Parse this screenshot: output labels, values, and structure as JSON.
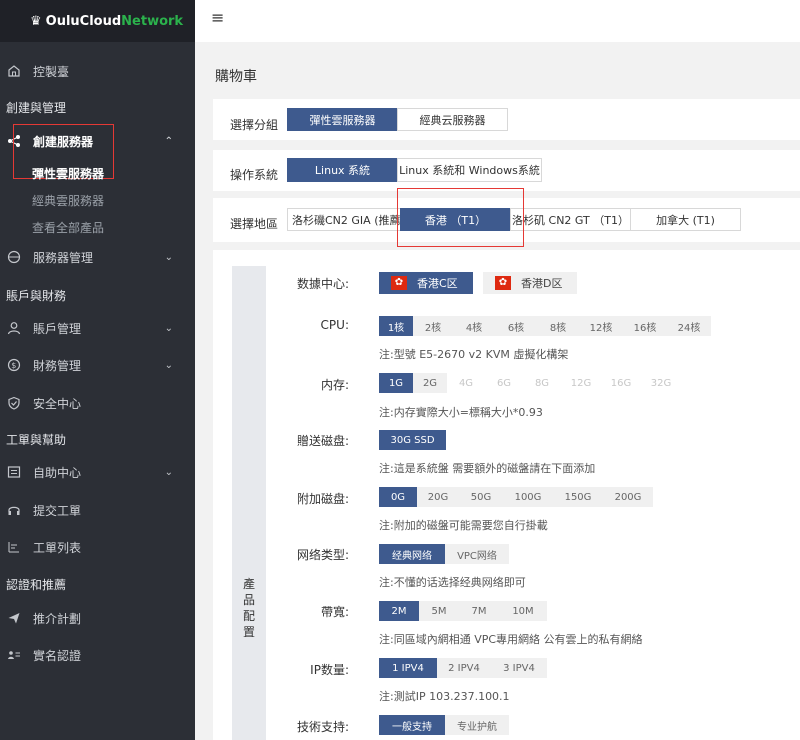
{
  "brand": {
    "logo_crown": "♛",
    "logo_white": "OuluCloud",
    "logo_green": "Network"
  },
  "sidebar": {
    "dashboard": "控製臺",
    "section_create": "創建與管理",
    "create_server": "創建服務器",
    "sub_elastic": "彈性雲服務器",
    "sub_classic": "經典雲服務器",
    "sub_all": "查看全部產品",
    "server_mgmt": "服務器管理",
    "section_account": "賬戶與財務",
    "account_mgmt": "賬戶管理",
    "finance_mgmt": "財務管理",
    "security": "安全中心",
    "section_ticket": "工單與幫助",
    "self_help": "自助中心",
    "submit_ticket": "提交工單",
    "ticket_list": "工單列表",
    "section_verify": "認證和推薦",
    "referral": "推介計劃",
    "realname": "實名認證"
  },
  "topbar": {
    "menu_icon": "≡"
  },
  "main": {
    "title": "購物車"
  },
  "group": {
    "label": "選擇分組",
    "options": [
      "彈性雲服務器",
      "經典云服務器"
    ],
    "selected": 0
  },
  "os": {
    "label": "操作系統",
    "options": [
      "Linux 系統",
      "Linux 系統和 Windows系統"
    ],
    "selected": 0
  },
  "region": {
    "label": "選擇地區",
    "options": [
      "洛杉磯CN2 GIA (推薦)",
      "香港 （T1）",
      "洛杉矶 CN2 GT （T1）",
      "加拿大 (T1)"
    ],
    "selected": 1
  },
  "config": {
    "band_label": "產品配置",
    "datacenter": {
      "label": "数據中心:",
      "options": [
        "香港C区",
        "香港D区"
      ],
      "selected": 0,
      "flag_glyph": "✿"
    },
    "cpu": {
      "label": "CPU:",
      "options": [
        "1核",
        "2核",
        "4核",
        "6核",
        "8核",
        "12核",
        "16核",
        "24核"
      ],
      "selected": 0,
      "note": "注:型號 E5-2670 v2 KVM 虛擬化構架"
    },
    "memory": {
      "label": "内存:",
      "options": [
        "1G",
        "2G",
        "4G",
        "6G",
        "8G",
        "12G",
        "16G",
        "32G"
      ],
      "selected": 0,
      "disabled_from": 2,
      "note": "注:内存實際大小=標稱大小*0.93"
    },
    "gift_disk": {
      "label": "贈送磁盘:",
      "options": [
        "30G SSD"
      ],
      "selected": 0,
      "note": "注:這是系統盤 需要額外的磁盤請在下面添加"
    },
    "extra_disk": {
      "label": "附加磁盘:",
      "options": [
        "0G",
        "20G",
        "50G",
        "100G",
        "150G",
        "200G"
      ],
      "selected": 0,
      "note": "注:附加的磁盤可能需要您自行掛載"
    },
    "net_type": {
      "label": "网络类型:",
      "options": [
        "经典网络",
        "VPC网络"
      ],
      "selected": 0,
      "note": "注:不懂的话选择经典网络即可"
    },
    "bandwidth": {
      "label": "帶寬:",
      "options": [
        "2M",
        "5M",
        "7M",
        "10M"
      ],
      "selected": 0,
      "note": "注:同區域內網相通 VPC專用網絡 公有雲上的私有網絡"
    },
    "ip": {
      "label": "IP数量:",
      "options": [
        "1 IPV4",
        "2 IPV4",
        "3 IPV4"
      ],
      "selected": 0,
      "note": "注:測試IP 103.237.100.1"
    },
    "support": {
      "label": "技術支持:",
      "options": [
        "一般支持",
        "专业护航"
      ],
      "selected": 0
    }
  }
}
